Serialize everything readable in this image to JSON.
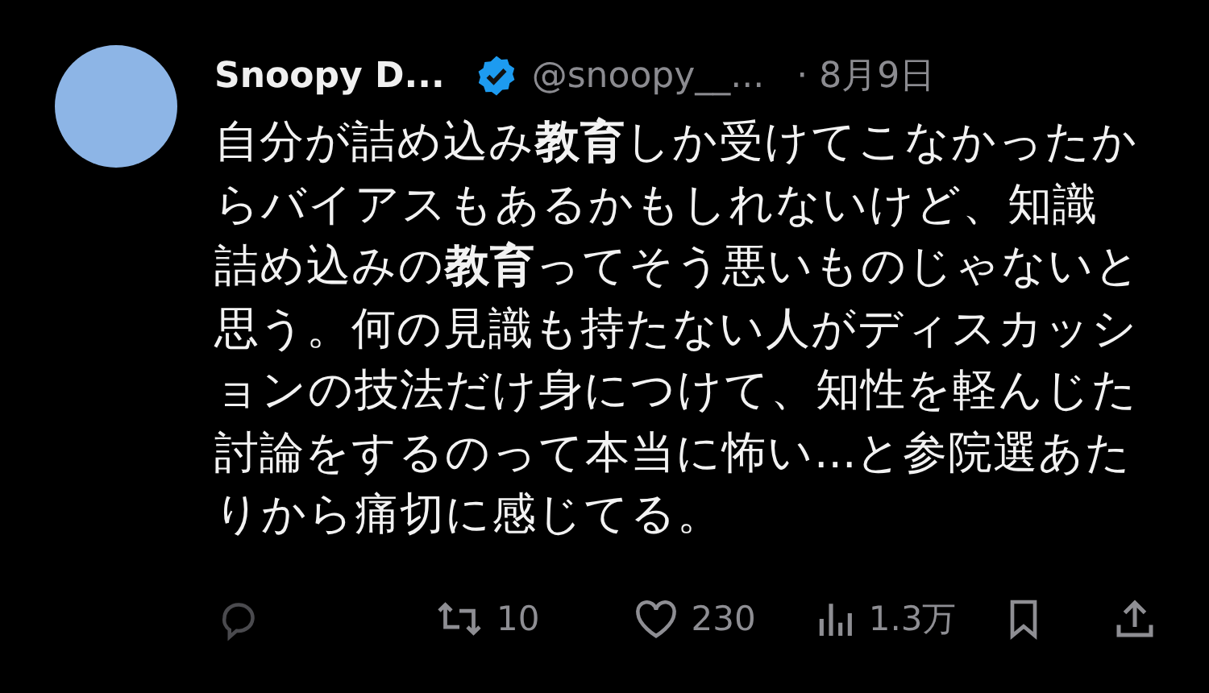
{
  "author": {
    "name": "Snoopy D...",
    "verified": true,
    "handle": "@snoopy__...",
    "time": "· 8月9日"
  },
  "text": "自分が詰め込み**教育**しか受けてこなかったからバイアスもあるかもしれないけど、知識詰め込みの**教育**ってそう悪いものじゃないと思う。何の見識も持たない人がディスカッションの技法だけ身につけて、知性を軽んじた討論をするのって本当に怖い...と参院選あたりから痛切に感じてる。",
  "actions": [
    {
      "kind": "reply"
    },
    {
      "kind": "repost",
      "count": "10"
    },
    {
      "kind": "like",
      "count": "230"
    },
    {
      "kind": "views",
      "count": "1.3万"
    },
    {
      "kind": "bookmark"
    },
    {
      "kind": "share"
    }
  ]
}
